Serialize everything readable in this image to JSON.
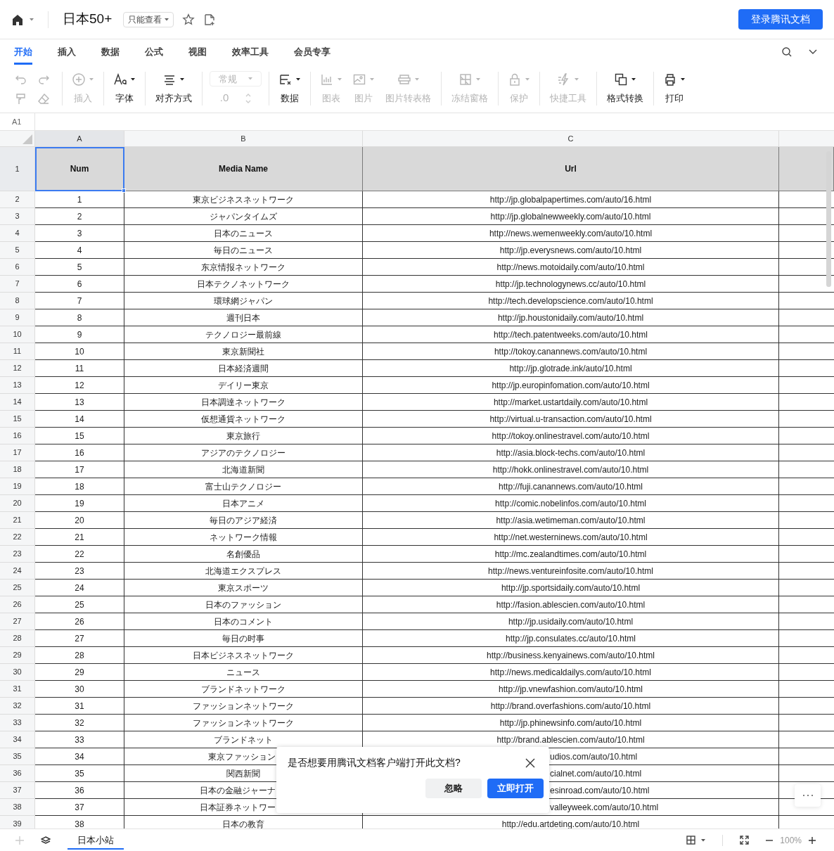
{
  "header": {
    "title": "日本50+",
    "permission": "只能查看",
    "login_button": "登录腾讯文档"
  },
  "tabs": [
    {
      "label": "开始",
      "selected": true
    },
    {
      "label": "插入",
      "selected": false
    },
    {
      "label": "数据",
      "selected": false
    },
    {
      "label": "公式",
      "selected": false
    },
    {
      "label": "视图",
      "selected": false
    },
    {
      "label": "效率工具",
      "selected": false
    },
    {
      "label": "会员专享",
      "selected": false
    }
  ],
  "toolbar": [
    [
      {
        "kind": "mini",
        "disabled": true
      },
      {
        "kind": "mini",
        "disabled": true
      },
      {
        "kind": "mini",
        "disabled": true
      },
      {
        "kind": "mini",
        "disabled": true
      }
    ],
    [
      {
        "kind": "button",
        "label": "插入",
        "disabled": true
      }
    ],
    [
      {
        "kind": "button",
        "label": "字体",
        "disabled": false
      }
    ],
    [
      {
        "kind": "button",
        "label": "对齐方式",
        "disabled": false
      }
    ],
    [
      {
        "kind": "number_format",
        "label": "常规",
        "value": ".0",
        "disabled": true
      }
    ],
    [
      {
        "kind": "button",
        "label": "数据",
        "disabled": false
      }
    ],
    [
      {
        "kind": "button",
        "label": "图表",
        "disabled": true
      },
      {
        "kind": "button",
        "label": "图片",
        "disabled": true
      },
      {
        "kind": "button",
        "label": "图片转表格",
        "disabled": true
      }
    ],
    [
      {
        "kind": "button",
        "label": "冻结窗格",
        "disabled": true
      }
    ],
    [
      {
        "kind": "button",
        "label": "保护",
        "disabled": true
      }
    ],
    [
      {
        "kind": "button",
        "label": "快捷工具",
        "disabled": true
      }
    ],
    [
      {
        "kind": "button",
        "label": "格式转换",
        "disabled": false
      }
    ],
    [
      {
        "kind": "button",
        "label": "打印",
        "disabled": false
      }
    ]
  ],
  "name_box": "A1",
  "table": {
    "columns": [
      {
        "label": "A",
        "selected": true
      },
      {
        "label": "B",
        "selected": false
      },
      {
        "label": "C",
        "selected": false
      }
    ],
    "header_row": {
      "number": "1",
      "cells": [
        "Num",
        "Media Name",
        "Url"
      ]
    },
    "rows": [
      {
        "number": "2",
        "cells": [
          "1",
          "東京ビジネスネットワーク",
          "http://jp.globalpapertimes.com/auto/16.html"
        ],
        "cut_name": false,
        "cut_url": false
      },
      {
        "number": "3",
        "cells": [
          "2",
          "ジャパンタイムズ",
          "http://jp.globalnewweekly.com/auto/10.html"
        ],
        "cut_name": false,
        "cut_url": false
      },
      {
        "number": "4",
        "cells": [
          "3",
          "日本のニュース",
          "http://news.wemenweekly.com/auto/10.html"
        ],
        "cut_name": false,
        "cut_url": false
      },
      {
        "number": "5",
        "cells": [
          "4",
          "毎日のニュース",
          "http://jp.everysnews.com/auto/10.html"
        ],
        "cut_name": false,
        "cut_url": false
      },
      {
        "number": "6",
        "cells": [
          "5",
          "东京情报ネットワーク",
          "http://news.motoidaily.com/auto/10.html"
        ],
        "cut_name": false,
        "cut_url": false
      },
      {
        "number": "7",
        "cells": [
          "6",
          "日本テクノネットワーク",
          "http://jp.technologynews.cc/auto/10.html"
        ],
        "cut_name": false,
        "cut_url": false
      },
      {
        "number": "8",
        "cells": [
          "7",
          "環球網ジャパン",
          "http://tech.developscience.com/auto/10.html"
        ],
        "cut_name": false,
        "cut_url": false
      },
      {
        "number": "9",
        "cells": [
          "8",
          "週刊日本",
          "http://jp.houstonidaily.com/auto/10.html"
        ],
        "cut_name": false,
        "cut_url": false
      },
      {
        "number": "10",
        "cells": [
          "9",
          "テクノロジー最前線",
          "http://tech.patentweeks.com/auto/10.html"
        ],
        "cut_name": false,
        "cut_url": false
      },
      {
        "number": "11",
        "cells": [
          "10",
          "東京新聞社",
          "http://tokoy.canannews.com/auto/10.html"
        ],
        "cut_name": false,
        "cut_url": false
      },
      {
        "number": "12",
        "cells": [
          "11",
          "日本経済週間",
          "http://jp.glotrade.ink/auto/10.html"
        ],
        "cut_name": false,
        "cut_url": false
      },
      {
        "number": "13",
        "cells": [
          "12",
          "デイリー東京",
          "http://jp.europinfomation.com/auto/10.html"
        ],
        "cut_name": false,
        "cut_url": false
      },
      {
        "number": "14",
        "cells": [
          "13",
          "日本調達ネットワーク",
          "http://market.ustartdaily.com/auto/10.html"
        ],
        "cut_name": false,
        "cut_url": false
      },
      {
        "number": "15",
        "cells": [
          "14",
          "仮想通貨ネットワーク",
          "http://virtual.u-transaction.com/auto/10.html"
        ],
        "cut_name": false,
        "cut_url": false
      },
      {
        "number": "16",
        "cells": [
          "15",
          "東京旅行",
          "http://tokoy.onlinestravel.com/auto/10.html"
        ],
        "cut_name": false,
        "cut_url": false
      },
      {
        "number": "17",
        "cells": [
          "16",
          "アジアのテクノロジー",
          "http://asia.block-techs.com/auto/10.html"
        ],
        "cut_name": false,
        "cut_url": false
      },
      {
        "number": "18",
        "cells": [
          "17",
          "北海道新聞",
          "http://hokk.onlinestravel.com/auto/10.html"
        ],
        "cut_name": false,
        "cut_url": false
      },
      {
        "number": "19",
        "cells": [
          "18",
          "富士山テクノロジー",
          "http://fuji.canannews.com/auto/10.html"
        ],
        "cut_name": false,
        "cut_url": false
      },
      {
        "number": "20",
        "cells": [
          "19",
          "日本アニメ",
          "http://comic.nobelinfos.com/auto/10.html"
        ],
        "cut_name": false,
        "cut_url": false
      },
      {
        "number": "21",
        "cells": [
          "20",
          "毎日のアジア経済",
          "http://asia.wetimeman.com/auto/10.html"
        ],
        "cut_name": false,
        "cut_url": false
      },
      {
        "number": "22",
        "cells": [
          "21",
          "ネットワーク情報",
          "http://net.westerninews.com/auto/10.html"
        ],
        "cut_name": false,
        "cut_url": false
      },
      {
        "number": "23",
        "cells": [
          "22",
          "名創優品",
          "http://mc.zealandtimes.com/auto/10.html"
        ],
        "cut_name": false,
        "cut_url": false
      },
      {
        "number": "24",
        "cells": [
          "23",
          "北海道エクスプレス",
          "http://news.ventureinfosite.com/auto/10.html"
        ],
        "cut_name": false,
        "cut_url": false
      },
      {
        "number": "25",
        "cells": [
          "24",
          "東京スポーツ",
          "http://jp.sportsidaily.com/auto/10.html"
        ],
        "cut_name": false,
        "cut_url": false
      },
      {
        "number": "26",
        "cells": [
          "25",
          "日本のファッション",
          "http://fasion.ablescien.com/auto/10.html"
        ],
        "cut_name": false,
        "cut_url": false
      },
      {
        "number": "27",
        "cells": [
          "26",
          "日本のコメント",
          "http://jp.usidaily.com/auto/10.html"
        ],
        "cut_name": false,
        "cut_url": false
      },
      {
        "number": "28",
        "cells": [
          "27",
          "毎日の时事",
          "http://jp.consulates.cc/auto/10.html"
        ],
        "cut_name": false,
        "cut_url": false
      },
      {
        "number": "29",
        "cells": [
          "28",
          "日本ビジネスネットワーク",
          "http://business.kenyainews.com/auto/10.html"
        ],
        "cut_name": false,
        "cut_url": false
      },
      {
        "number": "30",
        "cells": [
          "29",
          "ニュース",
          "http://news.medicaldailys.com/auto/10.html"
        ],
        "cut_name": false,
        "cut_url": false
      },
      {
        "number": "31",
        "cells": [
          "30",
          "ブランドネットワーク",
          "http://jp.vnewfashion.com/auto/10.html"
        ],
        "cut_name": false,
        "cut_url": false
      },
      {
        "number": "32",
        "cells": [
          "31",
          "ファッションネットワーク",
          "http://brand.overfashions.com/auto/10.html"
        ],
        "cut_name": false,
        "cut_url": false
      },
      {
        "number": "33",
        "cells": [
          "32",
          "ファッションネットワーク",
          "http://jp.phinewsinfo.com/auto/10.html"
        ],
        "cut_name": false,
        "cut_url": false
      },
      {
        "number": "34",
        "cells": [
          "33",
          "ブランドネット",
          "http://brand.ablescien.com/auto/10.html"
        ],
        "cut_name": false,
        "cut_url": false
      },
      {
        "number": "35",
        "cells": [
          "34",
          "東京ファッション",
          "udios.com/auto/10.html"
        ],
        "cut_name": true,
        "cut_url": true
      },
      {
        "number": "36",
        "cells": [
          "35",
          "関西新聞",
          "cialnet.com/auto/10.html"
        ],
        "cut_name": false,
        "cut_url": true
      },
      {
        "number": "37",
        "cells": [
          "36",
          "日本の金融ジャーナ",
          "esinroad.com/auto/10.html"
        ],
        "cut_name": true,
        "cut_url": true
      },
      {
        "number": "38",
        "cells": [
          "37",
          "日本証券ネットワー",
          "valleyweek.com/auto/10.html"
        ],
        "cut_name": true,
        "cut_url": true
      },
      {
        "number": "39",
        "cells": [
          "38",
          "日本の教育",
          "http://edu.artdeting.com/auto/10.html"
        ],
        "cut_name": false,
        "cut_url": false
      }
    ]
  },
  "dialog": {
    "message": "是否想要用腾讯文档客户端打开此文档?",
    "buttons": [
      {
        "label": "忽略",
        "primary": false
      },
      {
        "label": "立即打开",
        "primary": true
      }
    ]
  },
  "sheet_tabs": [
    {
      "label": "日本小站",
      "selected": true
    }
  ],
  "zoom": "100%"
}
